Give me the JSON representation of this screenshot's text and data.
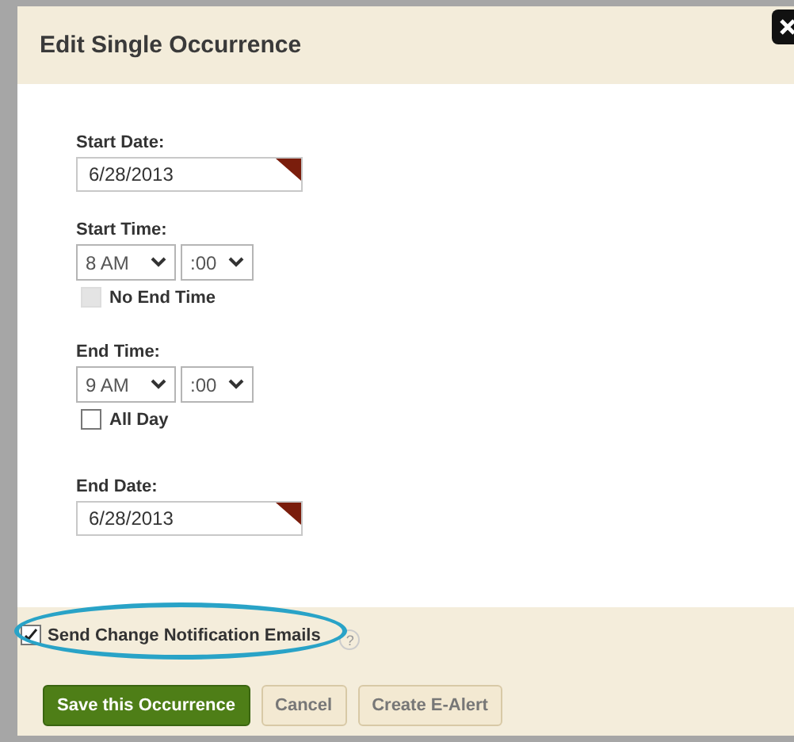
{
  "dialog": {
    "title": "Edit Single Occurrence"
  },
  "fields": [
    {
      "kind": "date",
      "label": "Start Date:",
      "value": "6/28/2013"
    },
    {
      "kind": "time",
      "label": "Start Time:",
      "hour": "8 AM",
      "minute": ":00",
      "option": {
        "label": "No End Time",
        "checked": false,
        "disabled": true
      }
    },
    {
      "kind": "time",
      "label": "End Time:",
      "hour": "9 AM",
      "minute": ":00",
      "option": {
        "label": "All Day",
        "checked": false,
        "disabled": false
      }
    },
    {
      "kind": "date",
      "label": "End Date:",
      "value": "6/28/2013"
    }
  ],
  "notification": {
    "label": "Send Change Notification Emails",
    "checked": true,
    "highlighted": true,
    "help": "?"
  },
  "buttons": [
    {
      "label": "Save this Occurrence",
      "kind": "primary"
    },
    {
      "label": "Cancel",
      "kind": "secondary"
    },
    {
      "label": "Create E-Alert",
      "kind": "secondary"
    }
  ]
}
